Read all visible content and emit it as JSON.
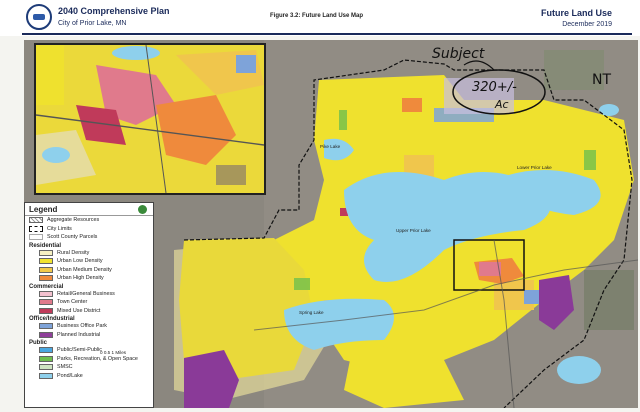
{
  "header": {
    "plan_title": "2040 Comprehensive Plan",
    "city": "City of Prior Lake, MN",
    "figure_title": "Figure 3.2: Future Land Use Map",
    "map_title": "Future Land Use",
    "date": "December 2019"
  },
  "legend": {
    "title": "Legend",
    "items_general": [
      {
        "label": "Aggregate Resources",
        "swatch": "#cccccc"
      },
      {
        "label": "City Limits",
        "swatch": "#ffffff"
      },
      {
        "label": "Scott County Parcels",
        "swatch": "#ffffff"
      }
    ],
    "sections": [
      {
        "name": "Residential",
        "items": [
          {
            "label": "Rural Density",
            "color": "#f6f1c2"
          },
          {
            "label": "Urban Low Density",
            "color": "#f2e431"
          },
          {
            "label": "Urban Medium Density",
            "color": "#f2c94a"
          },
          {
            "label": "Urban High Density",
            "color": "#ef8a3c"
          }
        ]
      },
      {
        "name": "Commercial",
        "items": [
          {
            "label": "Retail/General Business",
            "color": "#f3c1cf"
          },
          {
            "label": "Town Center",
            "color": "#e07a8c"
          },
          {
            "label": "Mixed Use District",
            "color": "#c03a5a"
          }
        ]
      },
      {
        "name": "Office/Industrial",
        "items": [
          {
            "label": "Business Office Park",
            "color": "#7ea3d9"
          },
          {
            "label": "Planned Industrial",
            "color": "#8f3f9a"
          }
        ]
      },
      {
        "name": "Public",
        "items": [
          {
            "label": "Public/Semi-Public",
            "color": "#4aa7e0"
          },
          {
            "label": "Parks, Recreation, & Open Space",
            "color": "#6fbf4e"
          },
          {
            "label": "SMSC",
            "color": "#cfe6c2"
          },
          {
            "label": "Pond/Lake",
            "color": "#8ed0ec"
          }
        ]
      }
    ],
    "scale_text": "0  0.5  1  Miles"
  },
  "annotations": {
    "subject": "Subject",
    "acres": "320+/-",
    "ac": "Ac",
    "nt": "NT"
  },
  "lakes": {
    "upper": "Upper Prior Lake",
    "lower": "Lower Prior Lake",
    "spring": "Spring Lake",
    "pike": "Pike Lake"
  }
}
